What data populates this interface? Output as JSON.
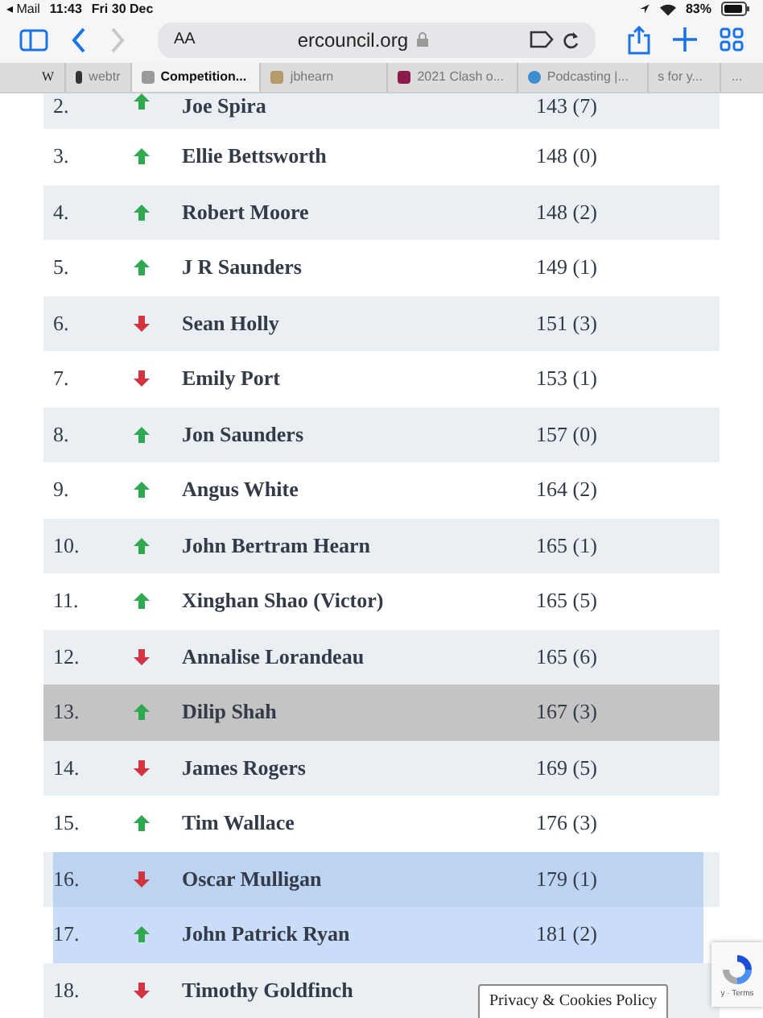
{
  "status_bar": {
    "back_app": "◂ Mail",
    "time": "11:43",
    "date": "Fri 30 Dec",
    "battery": "83%"
  },
  "toolbar": {
    "text_size": "AA",
    "address": "ercouncil.org"
  },
  "tabs": [
    {
      "label": "W",
      "selected": false
    },
    {
      "label": "webtr",
      "selected": false
    },
    {
      "label": "Competition...",
      "selected": true
    },
    {
      "label": "jbhearn",
      "selected": false
    },
    {
      "label": "2021 Clash o...",
      "selected": false
    },
    {
      "label": "Podcasting |...",
      "selected": false
    },
    {
      "label": "s for y...",
      "selected": false
    },
    {
      "label": "...",
      "selected": false
    }
  ],
  "rows": [
    {
      "rank": "2.",
      "kind": "up",
      "name": "Joe Spira",
      "score": "143 (7)",
      "highlighted": false,
      "text_selected": false
    },
    {
      "rank": "3.",
      "kind": "up",
      "name": "Ellie Bettsworth",
      "score": "148 (0)",
      "highlighted": false,
      "text_selected": false
    },
    {
      "rank": "4.",
      "kind": "up",
      "name": "Robert Moore",
      "score": "148 (2)",
      "highlighted": false,
      "text_selected": false
    },
    {
      "rank": "5.",
      "kind": "up",
      "name": "J R Saunders",
      "score": "149 (1)",
      "highlighted": false,
      "text_selected": false
    },
    {
      "rank": "6.",
      "kind": "down",
      "name": "Sean Holly",
      "score": "151 (3)",
      "highlighted": false,
      "text_selected": false
    },
    {
      "rank": "7.",
      "kind": "down",
      "name": "Emily Port",
      "score": "153 (1)",
      "highlighted": false,
      "text_selected": false
    },
    {
      "rank": "8.",
      "kind": "up",
      "name": "Jon Saunders",
      "score": "157 (0)",
      "highlighted": false,
      "text_selected": false
    },
    {
      "rank": "9.",
      "kind": "up",
      "name": "Angus White",
      "score": "164 (2)",
      "highlighted": false,
      "text_selected": false
    },
    {
      "rank": "10.",
      "kind": "up",
      "name": "John Bertram Hearn",
      "score": "165 (1)",
      "highlighted": false,
      "text_selected": false
    },
    {
      "rank": "11.",
      "kind": "up",
      "name": "Xinghan Shao (Victor)",
      "score": "165 (5)",
      "highlighted": false,
      "text_selected": false
    },
    {
      "rank": "12.",
      "kind": "down",
      "name": "Annalise Lorandeau",
      "score": "165 (6)",
      "highlighted": false,
      "text_selected": false
    },
    {
      "rank": "13.",
      "kind": "up",
      "name": "Dilip Shah",
      "score": "167 (3)",
      "highlighted": true,
      "text_selected": false
    },
    {
      "rank": "14.",
      "kind": "down",
      "name": "James Rogers",
      "score": "169 (5)",
      "highlighted": false,
      "text_selected": false
    },
    {
      "rank": "15.",
      "kind": "up",
      "name": "Tim Wallace",
      "score": "176 (3)",
      "highlighted": false,
      "text_selected": false
    },
    {
      "rank": "16.",
      "kind": "down",
      "name": "Oscar Mulligan",
      "score": "179 (1)",
      "highlighted": false,
      "text_selected": true
    },
    {
      "rank": "17.",
      "kind": "up",
      "name": "John Patrick Ryan",
      "score": "181 (2)",
      "highlighted": false,
      "text_selected": true
    },
    {
      "rank": "18.",
      "kind": "down",
      "name": "Timothy Goldfinch",
      "highlighted": false,
      "text_selected": false
    }
  ],
  "cookie_button": "Privacy & Cookies Policy",
  "recaptcha": {
    "links": "y · Terms"
  }
}
